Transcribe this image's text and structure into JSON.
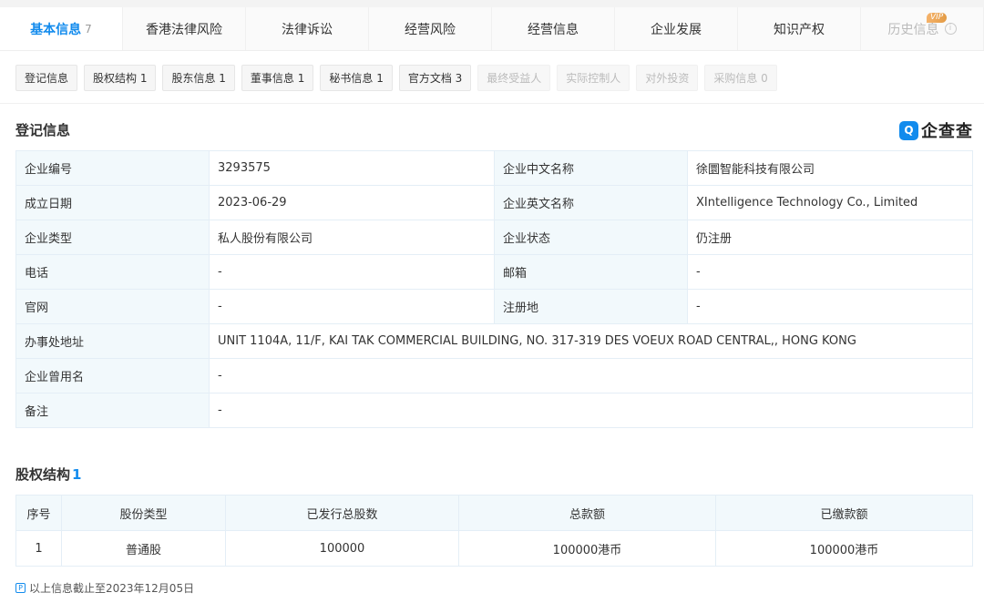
{
  "tabs": [
    {
      "label": "基本信息",
      "count": "7",
      "active": true
    },
    {
      "label": "香港法律风险"
    },
    {
      "label": "法律诉讼"
    },
    {
      "label": "经营风险"
    },
    {
      "label": "经营信息"
    },
    {
      "label": "企业发展"
    },
    {
      "label": "知识产权"
    },
    {
      "label": "历史信息",
      "badge": "VIP",
      "disabled": true
    }
  ],
  "subtabs": [
    {
      "label": "登记信息"
    },
    {
      "label": "股权结构 1"
    },
    {
      "label": "股东信息 1"
    },
    {
      "label": "董事信息 1"
    },
    {
      "label": "秘书信息 1"
    },
    {
      "label": "官方文档 3"
    },
    {
      "label": "最终受益人",
      "disabled": true
    },
    {
      "label": "实际控制人",
      "disabled": true
    },
    {
      "label": "对外投资",
      "disabled": true
    },
    {
      "label": "采购信息 0",
      "disabled": true
    }
  ],
  "registration": {
    "title": "登记信息",
    "logo_text": "企查查",
    "rows": [
      {
        "l1": "企业编号",
        "v1": "3293575",
        "l2": "企业中文名称",
        "v2": "徐圜智能科技有限公司"
      },
      {
        "l1": "成立日期",
        "v1": "2023-06-29",
        "l2": "企业英文名称",
        "v2": "XIntelligence Technology Co., Limited"
      },
      {
        "l1": "企业类型",
        "v1": "私人股份有限公司",
        "l2": "企业状态",
        "v2": "仍注册"
      },
      {
        "l1": "电话",
        "v1": "-",
        "l2": "邮箱",
        "v2": "-"
      },
      {
        "l1": "官网",
        "v1": "-",
        "l2": "注册地",
        "v2": "-"
      }
    ],
    "address_label": "办事处地址",
    "address_value": "UNIT 1104A, 11/F, KAI TAK COMMERCIAL BUILDING, NO. 317-319 DES VOEUX ROAD CENTRAL,, HONG KONG",
    "former_name_label": "企业曾用名",
    "former_name_value": "-",
    "remark_label": "备注",
    "remark_value": "-"
  },
  "equity": {
    "title": "股权结构",
    "count": "1",
    "headers": [
      "序号",
      "股份类型",
      "已发行总股数",
      "总款额",
      "已缴款额"
    ],
    "rows": [
      [
        "1",
        "普通股",
        "100000",
        "100000港币",
        "100000港币"
      ]
    ]
  },
  "footnote": "以上信息截止至2023年12月05日",
  "colors": {
    "accent": "#128bed",
    "label_bg": "#f2f9fc"
  }
}
